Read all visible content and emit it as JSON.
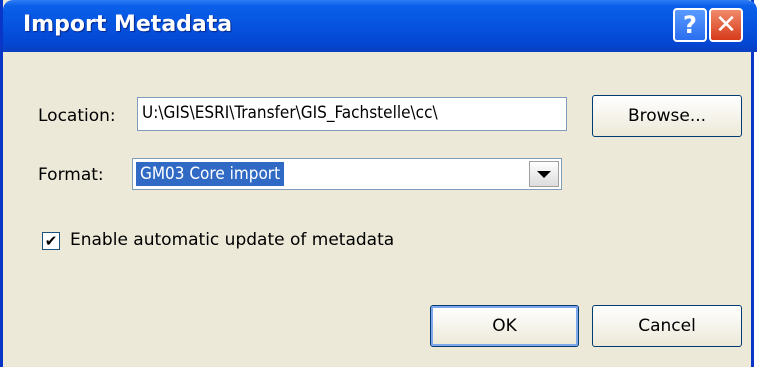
{
  "dialog": {
    "title": "Import Metadata",
    "help_glyph": "?",
    "close_glyph": "✕"
  },
  "location": {
    "label": "Location:",
    "value": "U:\\GIS\\ESRI\\Transfer\\GIS_Fachstelle\\cc\\",
    "browse_label": "Browse..."
  },
  "format": {
    "label": "Format:",
    "selected": "GM03 Core import"
  },
  "options": {
    "auto_update_label": "Enable automatic update of metadata",
    "auto_update_checked": true,
    "check_glyph": "✔"
  },
  "buttons": {
    "ok_label": "OK",
    "cancel_label": "Cancel"
  },
  "colors": {
    "titlebar": "#0553e0",
    "dialog_bg": "#ece9d8",
    "selection": "#316ac5",
    "close_button": "#d63a1a"
  },
  "icons": {
    "help": "help-icon",
    "close": "close-icon",
    "dropdown": "chevron-down-icon",
    "check": "checkmark-icon"
  }
}
